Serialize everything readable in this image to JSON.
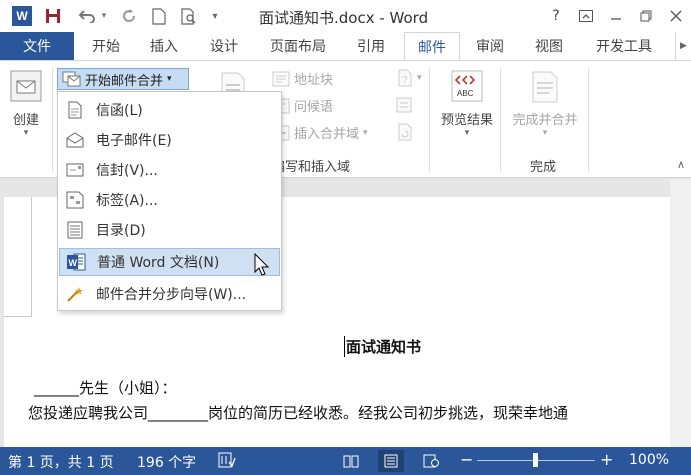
{
  "title_bar": {
    "app_logo": "W",
    "document_title": "面试通知书.docx - Word",
    "help": "?",
    "icons": [
      "save-icon",
      "undo-icon",
      "redo-icon",
      "new-doc-icon",
      "print-preview-icon",
      "customize-qat-icon"
    ]
  },
  "tabs": {
    "file": "文件",
    "items": [
      "开始",
      "插入",
      "设计",
      "页面布局",
      "引用",
      "邮件",
      "审阅",
      "视图",
      "开发工具"
    ],
    "active": "邮件"
  },
  "ribbon": {
    "create": {
      "label": "创建",
      "group_label": "创建"
    },
    "start_merge": {
      "label": "开始邮件合并"
    },
    "write_insert": {
      "address_block": "地址块",
      "greeting_line": "问候语",
      "insert_merge_field": "插入合并域",
      "group_label": "编写和插入域"
    },
    "preview": {
      "label": "预览结果",
      "icon_text": "ABC"
    },
    "finish": {
      "label": "完成并合并",
      "group_label": "完成"
    }
  },
  "menu": {
    "items": [
      {
        "label": "信函(L)",
        "icon": "letter-icon"
      },
      {
        "label": "电子邮件(E)",
        "icon": "email-icon"
      },
      {
        "label": "信封(V)...",
        "icon": "envelope-icon"
      },
      {
        "label": "标签(A)...",
        "icon": "label-icon"
      },
      {
        "label": "目录(D)",
        "icon": "directory-icon"
      },
      {
        "label": "普通 Word 文档(N)",
        "icon": "word-doc-icon"
      },
      {
        "label": "邮件合并分步向导(W)...",
        "icon": "wizard-icon"
      }
    ],
    "highlighted_index": 5
  },
  "document": {
    "heading": "面试通知书",
    "line1": "______先生（小姐）：",
    "line2": "    您投递应聘我公司________岗位的简历已经收悉。经我公司初步挑选，现荣幸地通"
  },
  "status_bar": {
    "page": "第 1 页，共 1 页",
    "words": "196 个字",
    "zoom": "100%",
    "zoom_minus": "−",
    "zoom_plus": "+"
  },
  "colors": {
    "accent": "#2b579a",
    "menu_highlight": "#cfe0f2"
  }
}
